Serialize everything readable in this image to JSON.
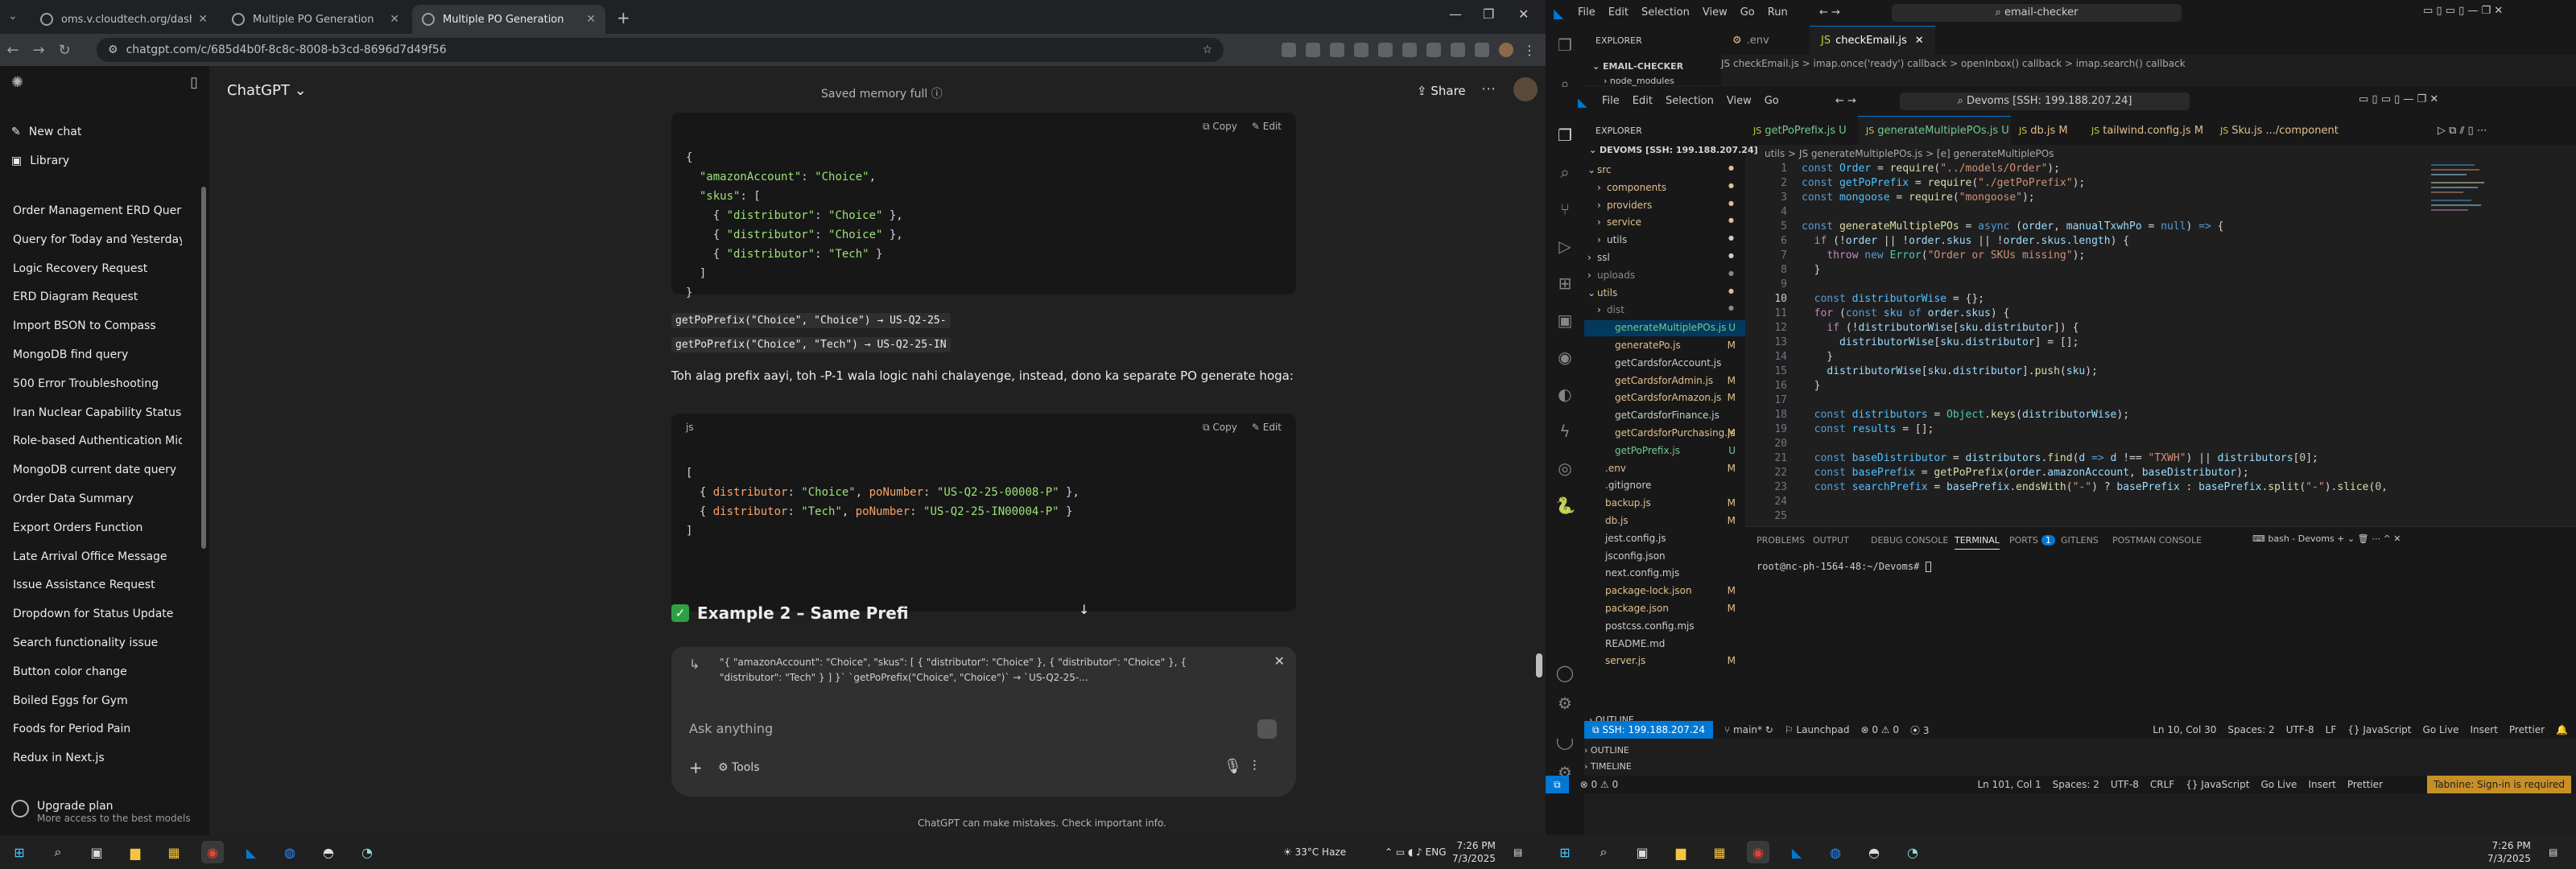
{
  "chrome": {
    "tabs": [
      {
        "title": "oms.v.cloudtech.org/dashboard"
      },
      {
        "title": "Multiple PO Generation"
      },
      {
        "title": "Multiple PO Generation"
      }
    ],
    "url": "chatgpt.com/c/685d4b0f-8c8c-8008-b3cd-8696d7d49f56"
  },
  "chatgpt": {
    "model": "ChatGPT",
    "memory": "Saved memory full",
    "share": "Share",
    "new_chat": "New chat",
    "library": "Library",
    "history": [
      "Order Management ERD Query",
      "Query for Today and Yesterday",
      "Logic Recovery Request",
      "ERD Diagram Request",
      "Import BSON to Compass",
      "MongoDB find query",
      "500 Error Troubleshooting",
      "Iran Nuclear Capability Status",
      "Role-based Authentication Mid...",
      "MongoDB current date query",
      "Order Data Summary",
      "Export Orders Function",
      "Late Arrival Office Message",
      "Issue Assistance Request",
      "Dropdown for Status Update",
      "Search functionality issue",
      "Button color change",
      "Boiled Eggs for Gym",
      "Foods for Period Pain",
      "Redux in Next.js"
    ],
    "upgrade_title": "Upgrade plan",
    "upgrade_sub": "More access to the best models",
    "copy": "Copy",
    "edit": "Edit",
    "code1": [
      "{",
      "  \"amazonAccount\": \"Choice\",",
      "  \"skus\": [",
      "    { \"distributor\": \"Choice\" },",
      "    { \"distributor\": \"Choice\" },",
      "    { \"distributor\": \"Tech\" }",
      "  ]",
      "}"
    ],
    "prefix_line1": "getPoPrefix(\"Choice\", \"Choice\") → US-Q2-25-",
    "prefix_line2": "getPoPrefix(\"Choice\", \"Tech\") → US-Q2-25-IN",
    "para": "Toh alag prefix aayi, toh -P-1 wala logic nahi chalayenge, instead, dono ka separate PO generate hoga:",
    "code2_lang": "js",
    "code2": [
      "[",
      "  { distributor: \"Choice\", poNumber: \"US-Q2-25-00008-P\" },",
      "  { distributor: \"Tech\", poNumber: \"US-Q2-25-IN00004-P\" }",
      "]"
    ],
    "example2": "Example 2 – Same Prefi",
    "quote": "\"{ \"amazonAccount\": \"Choice\", \"skus\": [ { \"distributor\": \"Choice\" }, { \"distributor\": \"Choice\" }, { \"distributor\": \"Tech\" } ] }` `getPoPrefix(\"Choice\", \"Choice\")` → `US-Q2-25-...",
    "ask": "Ask anything",
    "tools": "Tools",
    "disclaimer": "ChatGPT can make mistakes. Check important info."
  },
  "vscode_outer": {
    "menu": [
      "File",
      "Edit",
      "Selection",
      "View",
      "Go",
      "Run"
    ],
    "search": "email-checker",
    "explorer": "EXPLORER",
    "project": "EMAIL-CHECKER",
    "node_modules": "node_modules",
    "tabs": [
      ".env",
      "checkEmail.js"
    ],
    "breadcrumb": "JS checkEmail.js  >  imap.once('ready') callback  >  openInbox() callback  >  imap.search() callback",
    "outline": "OUTLINE",
    "timeline": "TIMELINE",
    "status": {
      "errors": "⊗ 0 ⚠ 0",
      "pos": "Ln 101, Col 1",
      "spaces": "Spaces: 2",
      "enc": "UTF-8",
      "eol": "CRLF",
      "lang": "{} JavaScript",
      "golive": "Go Live",
      "insert": "Insert",
      "prettier": "Prettier",
      "tabnine": "Tabnine: Sign-in is required"
    }
  },
  "vscode_inner": {
    "menu": [
      "File",
      "Edit",
      "Selection",
      "View",
      "Go"
    ],
    "search": "Devoms [SSH: 199.188.207.24]",
    "explorer": "EXPLORER",
    "root": "DEVOMS [SSH: 199.188.207.24]",
    "tree": [
      {
        "name": "src",
        "d": 1,
        "folder": true,
        "open": true,
        "c": "#e2c08d"
      },
      {
        "name": "components",
        "d": 2,
        "folder": true,
        "c": "#e2c08d"
      },
      {
        "name": "providers",
        "d": 2,
        "folder": true,
        "c": "#e2c08d"
      },
      {
        "name": "service",
        "d": 2,
        "folder": true,
        "c": "#e2c08d"
      },
      {
        "name": "utils",
        "d": 2,
        "folder": true,
        "c": "#ccc"
      },
      {
        "name": "ssl",
        "d": 1,
        "folder": true,
        "c": "#ccc"
      },
      {
        "name": "uploads",
        "d": 1,
        "folder": true,
        "c": "#8a8a8a"
      },
      {
        "name": "utils",
        "d": 1,
        "folder": true,
        "open": true,
        "c": "#e2c08d"
      },
      {
        "name": "dist",
        "d": 2,
        "folder": true,
        "c": "#8a8a8a"
      },
      {
        "name": "generateMultiplePOs.js",
        "d": 2,
        "c": "#73c991",
        "m": "U",
        "sel": true
      },
      {
        "name": "generatePo.js",
        "d": 2,
        "c": "#e2c08d",
        "m": "M"
      },
      {
        "name": "getCardsforAccount.js",
        "d": 2,
        "c": "#ccc"
      },
      {
        "name": "getCardsforAdmin.js",
        "d": 2,
        "c": "#e2c08d",
        "m": "M"
      },
      {
        "name": "getCardsforAmazon.js",
        "d": 2,
        "c": "#e2c08d",
        "m": "M"
      },
      {
        "name": "getCardsforFinance.js",
        "d": 2,
        "c": "#ccc"
      },
      {
        "name": "getCardsforPurchasing.js",
        "d": 2,
        "c": "#e2c08d",
        "m": "M"
      },
      {
        "name": "getPoPrefix.js",
        "d": 2,
        "c": "#73c991",
        "m": "U"
      },
      {
        "name": ".env",
        "d": 1,
        "c": "#e2c08d",
        "m": "M"
      },
      {
        "name": ".gitignore",
        "d": 1,
        "c": "#ccc"
      },
      {
        "name": "backup.js",
        "d": 1,
        "c": "#e2c08d",
        "m": "M"
      },
      {
        "name": "db.js",
        "d": 1,
        "c": "#e2c08d",
        "m": "M"
      },
      {
        "name": "jest.config.js",
        "d": 1,
        "c": "#ccc"
      },
      {
        "name": "jsconfig.json",
        "d": 1,
        "c": "#ccc"
      },
      {
        "name": "next.config.mjs",
        "d": 1,
        "c": "#ccc"
      },
      {
        "name": "package-lock.json",
        "d": 1,
        "c": "#e2c08d",
        "m": "M"
      },
      {
        "name": "package.json",
        "d": 1,
        "c": "#e2c08d",
        "m": "M"
      },
      {
        "name": "postcss.config.mjs",
        "d": 1,
        "c": "#ccc"
      },
      {
        "name": "README.md",
        "d": 1,
        "c": "#ccc"
      },
      {
        "name": "server.js",
        "d": 1,
        "c": "#e2c08d",
        "m": "M"
      }
    ],
    "outline": "OUTLINE",
    "timeline": "TIMELINE",
    "tabs": [
      {
        "name": "getPoPrefix.js U",
        "c": "#73c991"
      },
      {
        "name": "generateMultiplePOs.js U",
        "c": "#73c991",
        "active": true
      },
      {
        "name": "db.js M",
        "c": "#e2c08d"
      },
      {
        "name": "tailwind.config.js M",
        "c": "#e2c08d"
      },
      {
        "name": "Sku.js .../component",
        "c": "#e2c08d"
      }
    ],
    "breadcrumb": "utils > JS generateMultiplePOs.js > [e] generateMultiplePOs",
    "lines": [
      "1",
      "2",
      "3",
      "4",
      "5",
      "6",
      "7",
      "8",
      "9",
      "10",
      "11",
      "12",
      "13",
      "14",
      "15",
      "16",
      "17",
      "18",
      "19",
      "20",
      "21",
      "22",
      "23",
      "24",
      "25"
    ],
    "panel_tabs": [
      "PROBLEMS",
      "OUTPUT",
      "DEBUG CONSOLE",
      "TERMINAL",
      "PORTS",
      "GITLENS",
      "POSTMAN CONSOLE"
    ],
    "ports_badge": "1",
    "term_shell": "bash - Devoms",
    "prompt": "root@nc-ph-1564-48:~/Devoms# ",
    "status": {
      "remote": "SSH: 199.188.207.24",
      "branch": "main*",
      "launch": "Launchpad",
      "probs": "⊗ 0 ⚠ 0",
      "ports": "3",
      "pos": "Ln 10, Col 30",
      "spaces": "Spaces: 2",
      "enc": "UTF-8",
      "eol": "LF",
      "lang": "{} JavaScript",
      "golive": "Go Live",
      "insert": "Insert",
      "prettier": "Prettier"
    }
  },
  "taskbar_left": {
    "weather": "33°C Haze",
    "time": "7:26 PM",
    "date": "7/3/2025"
  },
  "taskbar_right": {
    "time": "7:26 PM",
    "date": "7/3/2025"
  },
  "colors": {
    "accent": "#0078d4",
    "check": "#2ea043",
    "tabnine": "#c69026"
  }
}
